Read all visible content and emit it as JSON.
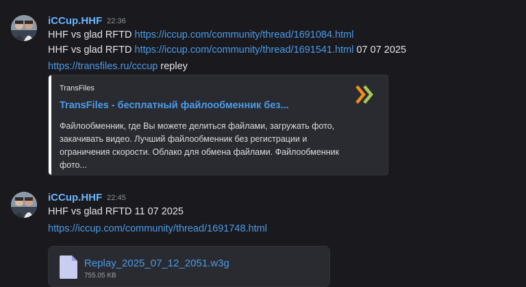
{
  "messages": [
    {
      "username": "iCCup.HHF",
      "time": "22:36",
      "line1": {
        "text": "HHF vs glad RFTD ",
        "link": "https://iccup.com/community/thread/1691084.html"
      },
      "line2": {
        "text": "HHF vs glad RFTD ",
        "link": "https://iccup.com/community/thread/1691541.html",
        "suffix": " 07 07 2025"
      },
      "line3": {
        "link": "https://transfiles.ru/cccup",
        "suffix": " repley"
      },
      "embed": {
        "provider": "TransFiles",
        "title": "TransFiles - бесплатный файлообменник без...",
        "description": "Файлообменник, где Вы можете делиться файлами, загружать фото, закачивать видео. Лучший файлообменник без регистрации и ограничения скорости. Облако для обмена файлами. Файлообменник фото...",
        "thumb_icon": "double-chevron-icon"
      }
    },
    {
      "username": "iCCup.HHF",
      "time": "22:45",
      "line1": {
        "text": "HHF vs glad RFTD 11 07 2025"
      },
      "line2": {
        "link": "https://iccup.com/community/thread/1691748.html"
      },
      "attachment": {
        "filename": "Replay_2025_07_12_2051.w3g",
        "size": "755.05 KB",
        "icon": "file-icon"
      }
    }
  ],
  "colors": {
    "background": "#1a1a1e",
    "username": "#6cb6ff",
    "link": "#4b9be8",
    "embed_bg": "#2a2b30"
  }
}
